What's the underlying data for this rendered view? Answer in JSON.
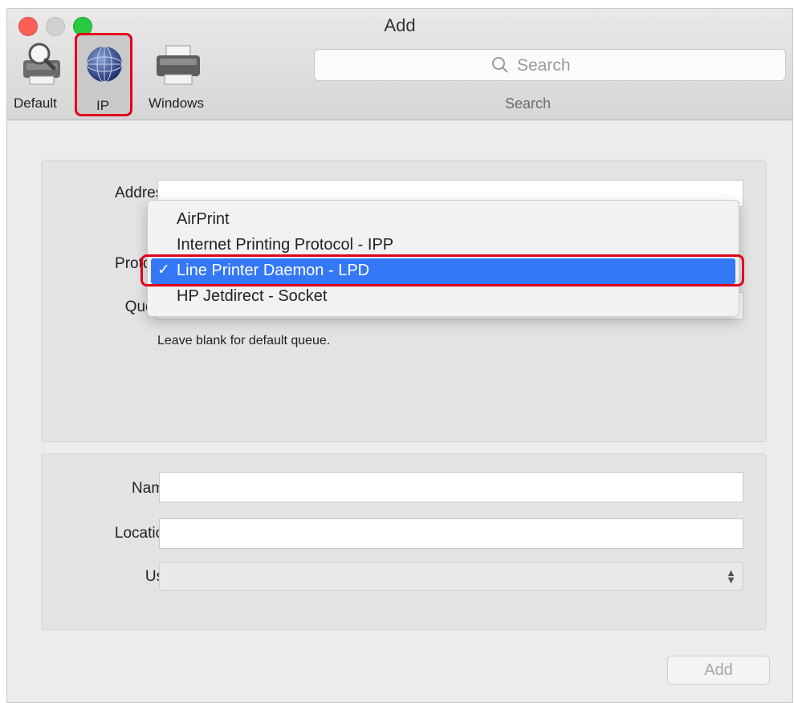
{
  "window": {
    "title": "Add"
  },
  "toolbar": {
    "items": [
      {
        "label": "Default",
        "icon": "printer-magnifier-icon"
      },
      {
        "label": "IP",
        "icon": "globe-icon",
        "selected": true
      },
      {
        "label": "Windows",
        "icon": "printer-icon"
      }
    ],
    "search_placeholder": "Search",
    "search_label": "Search"
  },
  "form": {
    "address_label": "Address:",
    "address_value": "",
    "protocol_label": "Protocol:",
    "queue_label": "Queue:",
    "queue_value": "",
    "queue_hint": "Leave blank for default queue.",
    "name_label": "Name:",
    "name_value": "",
    "location_label": "Location:",
    "location_value": "",
    "use_label": "Use:",
    "use_value": ""
  },
  "protocol_menu": {
    "options": [
      "AirPrint",
      "Internet Printing Protocol - IPP",
      "Line Printer Daemon - LPD",
      "HP Jetdirect - Socket"
    ],
    "selected_index": 2
  },
  "footer": {
    "add_label": "Add"
  },
  "colors": {
    "highlight": "#e0001b",
    "selection": "#3478f6",
    "close": "#fc5f57",
    "zoom": "#29c940"
  }
}
